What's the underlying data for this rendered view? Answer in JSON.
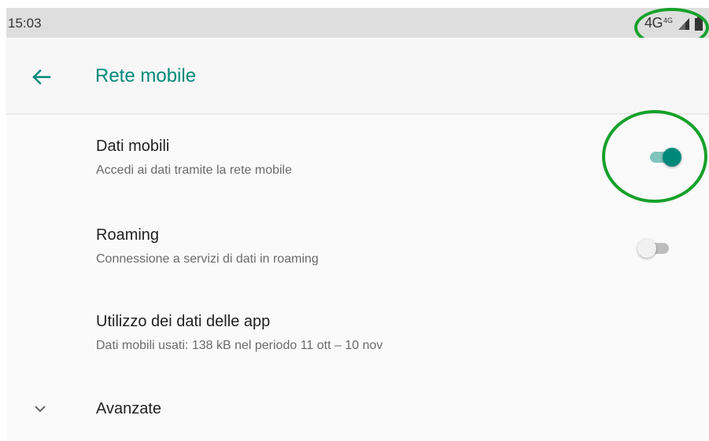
{
  "status_bar": {
    "time": "15:03",
    "network": "4G",
    "network_small": "4G"
  },
  "app_bar": {
    "title": "Rete mobile"
  },
  "preferences": [
    {
      "title": "Dati mobili",
      "summary": "Accedi ai dati tramite la rete mobile",
      "switch_on": true
    },
    {
      "title": "Roaming",
      "summary": "Connessione a servizi di dati in roaming",
      "switch_on": false
    },
    {
      "title": "Utilizzo dei dati delle app",
      "summary": "Dati mobili usati: 138 kB nel periodo 11 ott – 10 nov"
    }
  ],
  "advanced": {
    "label": "Avanzate"
  },
  "icons": {
    "back": "arrow-back-icon",
    "signal": "signal-icon",
    "battery": "battery-icon",
    "expand": "chevron-down-icon"
  },
  "colors": {
    "accent": "#00897b",
    "annotation": "#16a12a"
  }
}
